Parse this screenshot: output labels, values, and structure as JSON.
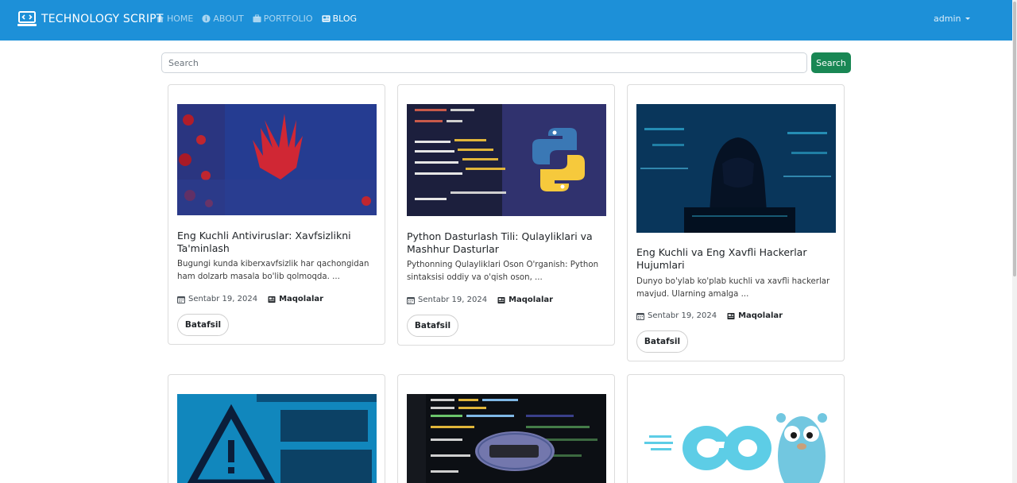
{
  "navbar": {
    "brand": "TECHNOLOGY SCRIPT",
    "links": [
      {
        "label": "HOME",
        "icon": "home-icon"
      },
      {
        "label": "ABOUT",
        "icon": "info-icon"
      },
      {
        "label": "PORTFOLIO",
        "icon": "briefcase-icon"
      },
      {
        "label": "BLOG",
        "icon": "newspaper-icon"
      }
    ],
    "active": "BLOG",
    "user": "admin"
  },
  "search": {
    "placeholder": "Search",
    "value": "",
    "button_label": "Search"
  },
  "cards": [
    {
      "image": "virus-alert-image",
      "title": "Eng Kuchli Antiviruslar: Xavfsizlikni Ta'minlash",
      "excerpt": "Bugungi kunda kiberxavfsizlik har qachongidan ham dolzarb masala bo'lib qolmoqda. ...",
      "date": "Sentabr 19, 2024",
      "category": "Maqolalar",
      "button": "Batafsil"
    },
    {
      "image": "python-code-image",
      "title": "Python Dasturlash Tili: Qulayliklari va Mashhur Dasturlar",
      "excerpt": "Pythonning Qulayliklari Oson O'rganish: Python sintaksisi oddiy va o'qish oson, ...",
      "date": "Sentabr 19, 2024",
      "category": "Maqolalar",
      "button": "Batafsil"
    },
    {
      "image": "hacker-image",
      "title": "Eng Kuchli va Eng Xavfli Hackerlar Hujumlari",
      "excerpt": "Dunyo bo'ylab ko'plab kuchli va xavfli hackerlar mavjud. Ularning amalga ...",
      "date": "Sentabr 19, 2024",
      "category": "Maqolalar",
      "button": "Batafsil"
    },
    {
      "image": "virus-detected-image"
    },
    {
      "image": "php-code-image"
    },
    {
      "image": "go-gopher-image"
    }
  ]
}
